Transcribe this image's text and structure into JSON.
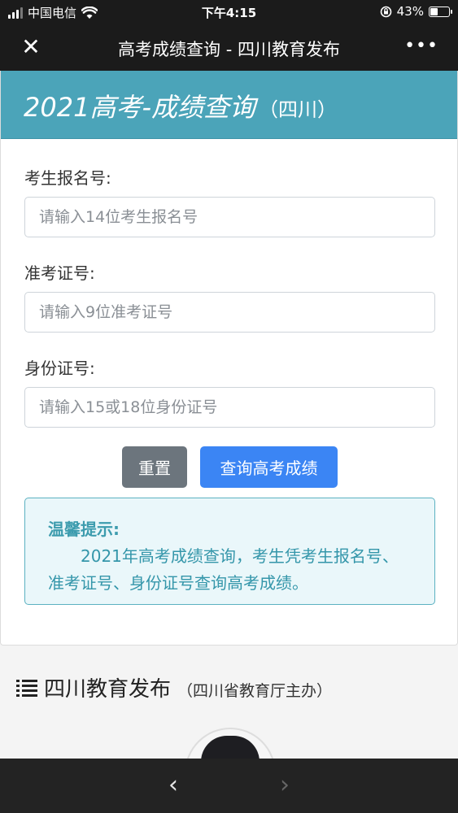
{
  "status_bar": {
    "carrier": "中国电信",
    "time": "下午4:15",
    "battery": "43%",
    "battery_level": 0.43
  },
  "nav": {
    "title": "高考成绩查询 - 四川教育发布",
    "close_icon": "close-icon",
    "more_icon": "more-icon"
  },
  "form": {
    "title": "2021高考-成绩查询",
    "title_sub": "（四川）",
    "fields": [
      {
        "label": "考生报名号:",
        "placeholder": "请输入14位考生报名号",
        "value": ""
      },
      {
        "label": "准考证号:",
        "placeholder": "请输入9位准考证号",
        "value": ""
      },
      {
        "label": "身份证号:",
        "placeholder": "请输入15或18位身份证号",
        "value": ""
      }
    ],
    "reset_label": "重置",
    "query_label": "查询高考成绩"
  },
  "tip": {
    "title": "温馨提示:",
    "body": "2021年高考成绩查询，考生凭考生报名号、准考证号、身份证号查询高考成绩。"
  },
  "account": {
    "name": "四川教育发布",
    "sponsor": "（四川省教育厅主办）",
    "icon": "list-icon"
  },
  "colors": {
    "header": "#4ba4b9",
    "primary": "#3b85f4",
    "secondary": "#6c757d",
    "tip_text": "#3496aa"
  }
}
